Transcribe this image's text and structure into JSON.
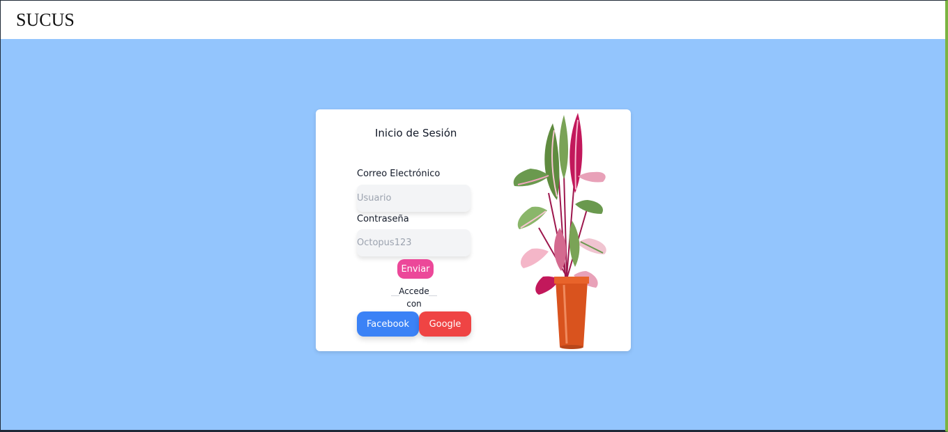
{
  "navbar": {
    "brand": "SUCUS"
  },
  "login": {
    "title": "Inicio de Sesión",
    "email_label": "Correo Electrónico",
    "email_placeholder": "Usuario",
    "password_label": "Contraseña",
    "password_placeholder": "Octopus123",
    "submit_label": "Enviar",
    "divider_text": "Accede con",
    "facebook_label": "Facebook",
    "google_label": "Google"
  },
  "colors": {
    "page_background": "#93c5fd",
    "submit_button": "#ec4899",
    "facebook_button": "#3b82f6",
    "google_button": "#ef4444"
  },
  "icons": {
    "plant_image": "potted-plant-image"
  }
}
